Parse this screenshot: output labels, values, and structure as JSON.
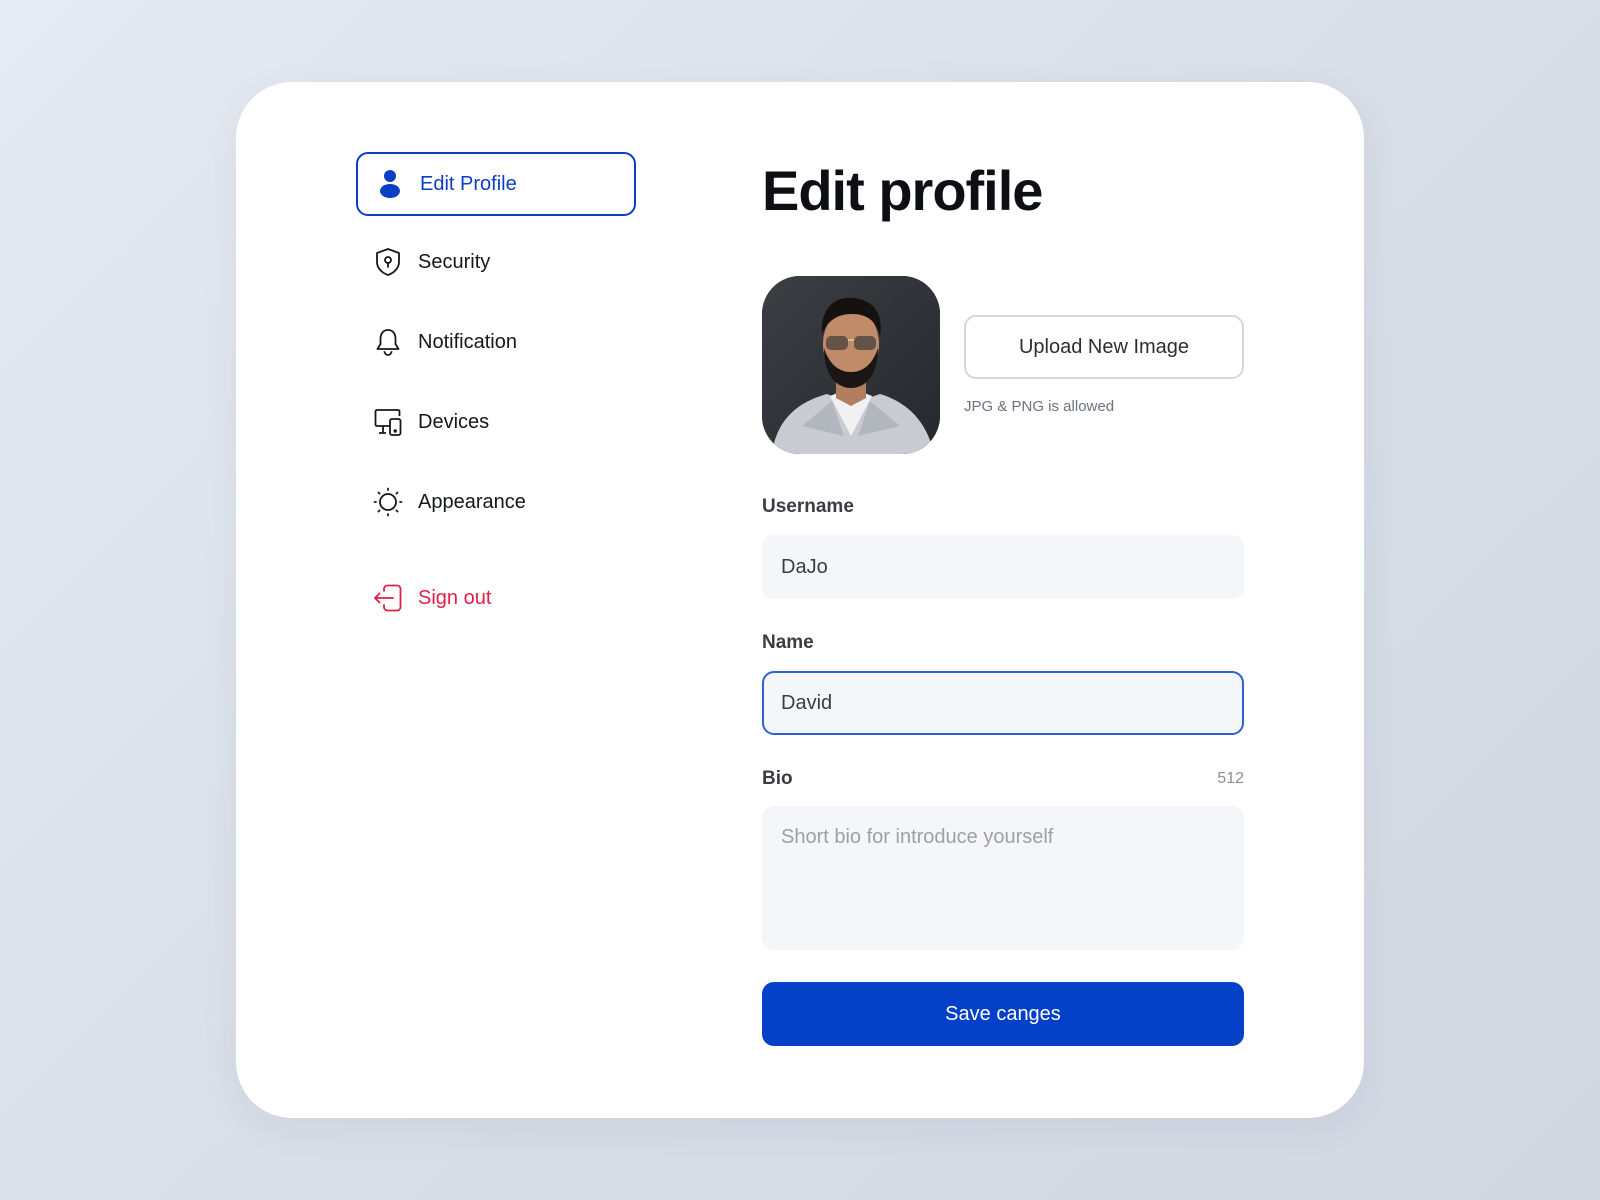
{
  "sidebar": {
    "items": [
      {
        "label": "Edit Profile",
        "icon": "user-icon",
        "active": true
      },
      {
        "label": "Security",
        "icon": "shield-lock-icon"
      },
      {
        "label": "Notification",
        "icon": "bell-icon"
      },
      {
        "label": "Devices",
        "icon": "devices-icon"
      },
      {
        "label": "Appearance",
        "icon": "sun-icon"
      }
    ],
    "signout": {
      "label": "Sign out",
      "icon": "sign-out-icon"
    }
  },
  "main": {
    "title": "Edit profile",
    "avatar": {
      "icon": "profile-photo"
    },
    "upload": {
      "label": "Upload New Image",
      "hint": "JPG & PNG is allowed"
    },
    "username": {
      "label": "Username",
      "value": "DaJo"
    },
    "name": {
      "label": "Name",
      "value": "David"
    },
    "bio": {
      "label": "Bio",
      "counter": "512",
      "placeholder": "Short bio for introduce yourself"
    },
    "save_label": "Save canges"
  },
  "colors": {
    "accent": "#0440c8",
    "active_nav": "#0b3ec4",
    "danger": "#e11d48",
    "field_bg": "#f5f6f9"
  }
}
